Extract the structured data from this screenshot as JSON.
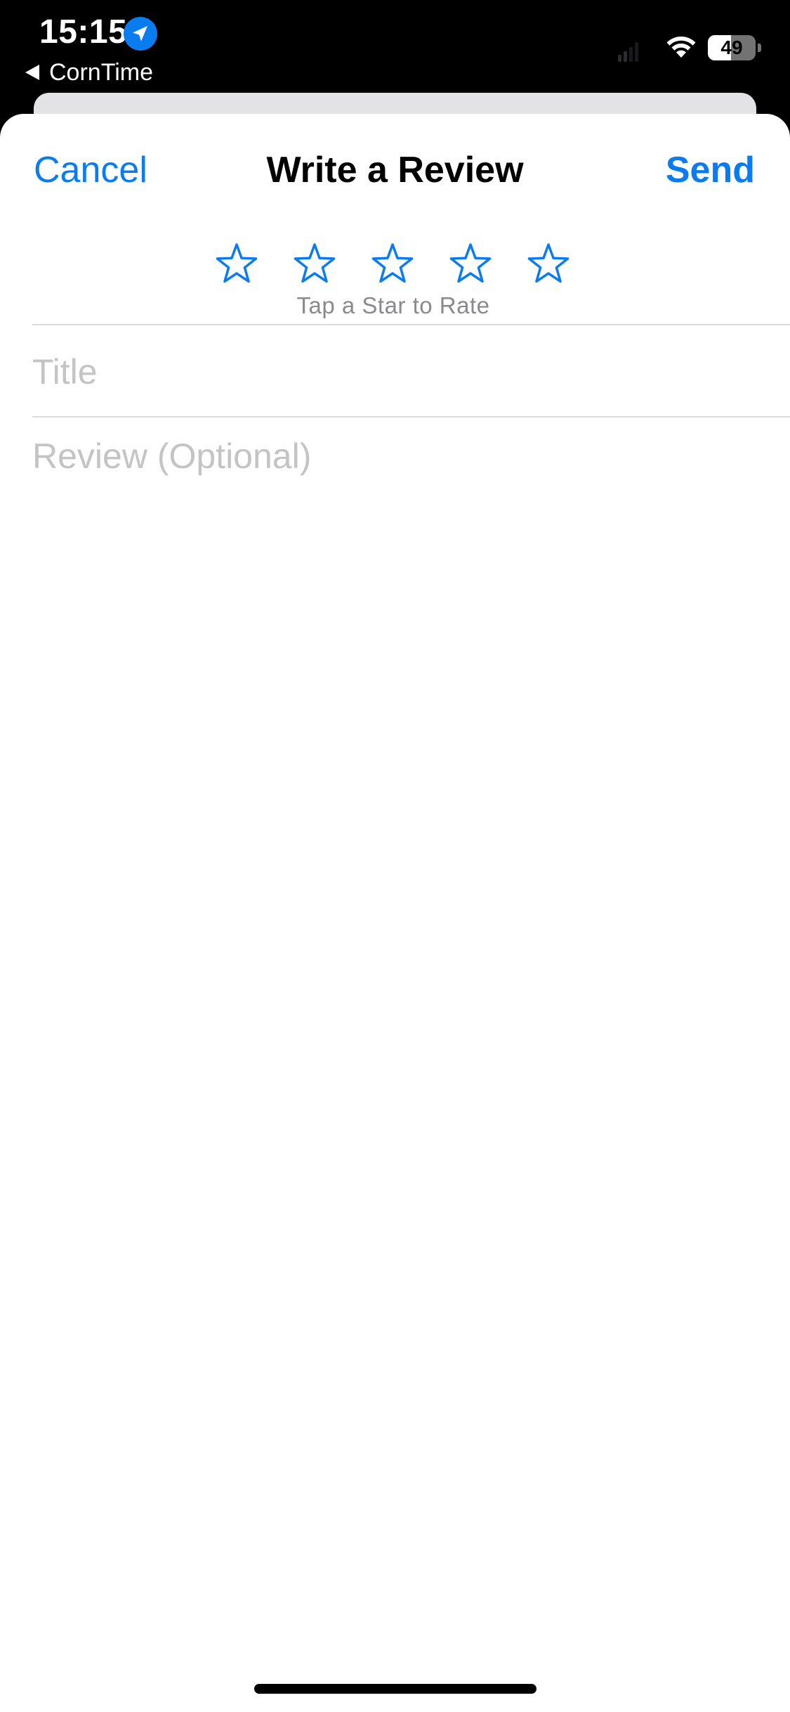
{
  "status_bar": {
    "time": "15:15",
    "location_icon": "location-arrow-icon",
    "back_app_label": "CornTime",
    "signal_icon": "cellular-signal-icon",
    "wifi_icon": "wifi-icon",
    "battery_percent": "49",
    "battery_level": 0.49
  },
  "nav": {
    "cancel_label": "Cancel",
    "title": "Write a Review",
    "send_label": "Send"
  },
  "rating": {
    "stars": 5,
    "selected": 0,
    "hint": "Tap a Star to Rate",
    "star_icon": "star-outline-icon"
  },
  "form": {
    "title_placeholder": "Title",
    "title_value": "",
    "review_placeholder": "Review (Optional)",
    "review_value": ""
  },
  "colors": {
    "accent": "#0a7cf0",
    "placeholder": "#c4c4c7",
    "hint": "#8a8a8e",
    "divider": "#dcdcdf"
  }
}
